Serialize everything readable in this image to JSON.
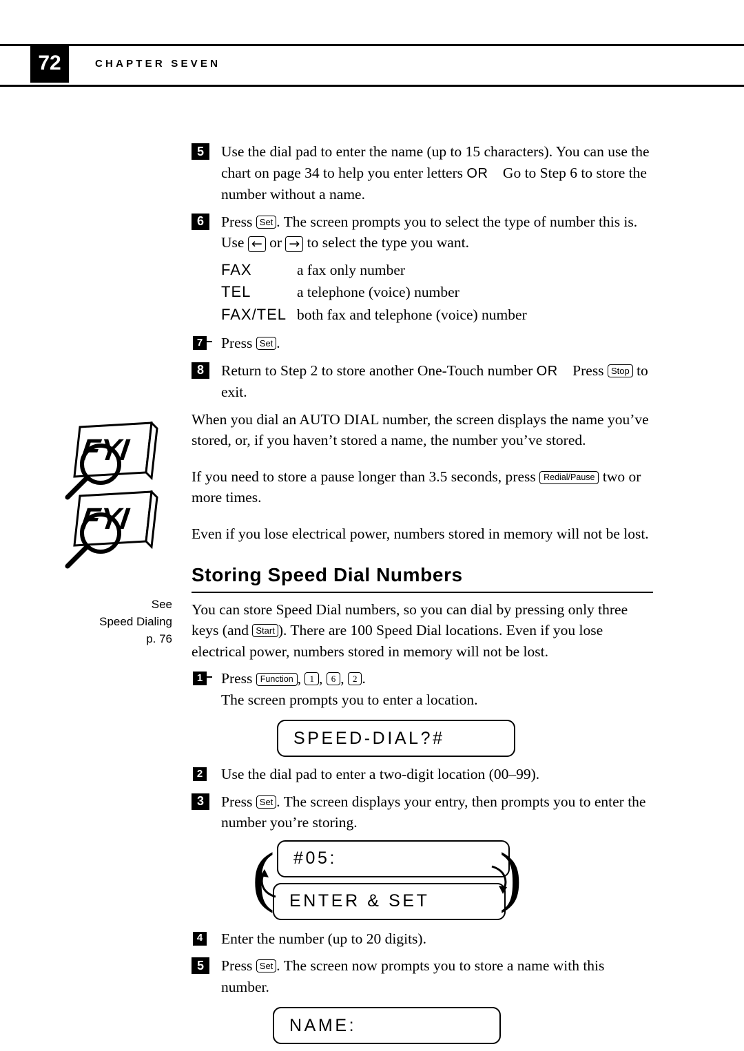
{
  "header": {
    "page_number": "72",
    "chapter_label": "CHAPTER SEVEN"
  },
  "steps_top": [
    {
      "num": "5",
      "parts": {
        "t1": "Use the dial pad to enter the name (up to 15 characters). You can use the chart on page 34 to help you enter letters ",
        "or": "OR",
        "t2": "Go to Step 6 to store the number without a name."
      }
    },
    {
      "num": "6",
      "parts": {
        "t1": "Press ",
        "key": "Set",
        "t2": ". The screen prompts you to select the type of number this is. Use ",
        "t3": " or ",
        "t4": " to select the type you want."
      }
    },
    {
      "num": "7",
      "parts": {
        "t1": "Press ",
        "key": "Set",
        "t2": "."
      }
    },
    {
      "num": "8",
      "parts": {
        "t1": "Return to Step 2 to store another One-Touch number ",
        "or": "OR",
        "t2": "Press ",
        "key": "Stop",
        "t3": " to exit."
      }
    }
  ],
  "number_types": [
    {
      "key": "FAX",
      "desc": "a fax only number"
    },
    {
      "key": "TEL",
      "desc": "a telephone (voice) number"
    },
    {
      "key": "FAX/TEL",
      "desc": "both fax and telephone (voice) number"
    }
  ],
  "body_paragraphs": {
    "auto_dial": "When you dial an AUTO DIAL number, the screen displays the name you’ve stored, or, if you haven’t stored a name, the number you’ve stored.",
    "pause_1": "If you need to store a pause longer than 3.5 seconds, press ",
    "pause_key": "Redial/Pause",
    "pause_2": " two or more times.",
    "power_loss": "Even if you lose electrical power, numbers stored in memory will not be lost."
  },
  "section": {
    "title": "Storing Speed Dial Numbers",
    "intro_1": "You can store Speed Dial numbers, so you can dial by pressing only three keys (and ",
    "intro_key": "Start",
    "intro_2": "). There are 100 Speed Dial locations. Even if you lose electrical power, numbers stored in memory will not be lost."
  },
  "side_note": {
    "line1": "See",
    "line2": "Speed Dialing",
    "line3": "p. 76"
  },
  "steps_speed": [
    {
      "num": "1",
      "parts": {
        "t1": "Press ",
        "key1": "Function",
        "t2": ", ",
        "key2": "1",
        "t3": ", ",
        "key3": "6",
        "t4": ", ",
        "key4": "2",
        "t5": ".",
        "t6": "The screen prompts you to enter a location."
      }
    },
    {
      "num": "2",
      "parts": {
        "t1": "Use the dial pad to enter a two-digit location (00–99)."
      }
    },
    {
      "num": "3",
      "parts": {
        "t1": "Press ",
        "key": "Set",
        "t2": ". The screen displays your entry, then prompts you to enter the number you’re storing."
      }
    },
    {
      "num": "4",
      "parts": {
        "t1": "Enter the number (up to 20 digits)."
      }
    },
    {
      "num": "5",
      "parts": {
        "t1": "Press ",
        "key": "Set",
        "t2": ". The screen now prompts you to store a name with this number."
      }
    }
  ],
  "lcd_displays": {
    "speed_dial_prompt": "SPEED-DIAL?#",
    "entry_number": "#05:",
    "enter_and_set": "ENTER & SET",
    "name_prompt": "NAME:"
  },
  "icons": {
    "fyi_label": "FYI",
    "left_arrow": "←",
    "right_arrow": "→"
  }
}
